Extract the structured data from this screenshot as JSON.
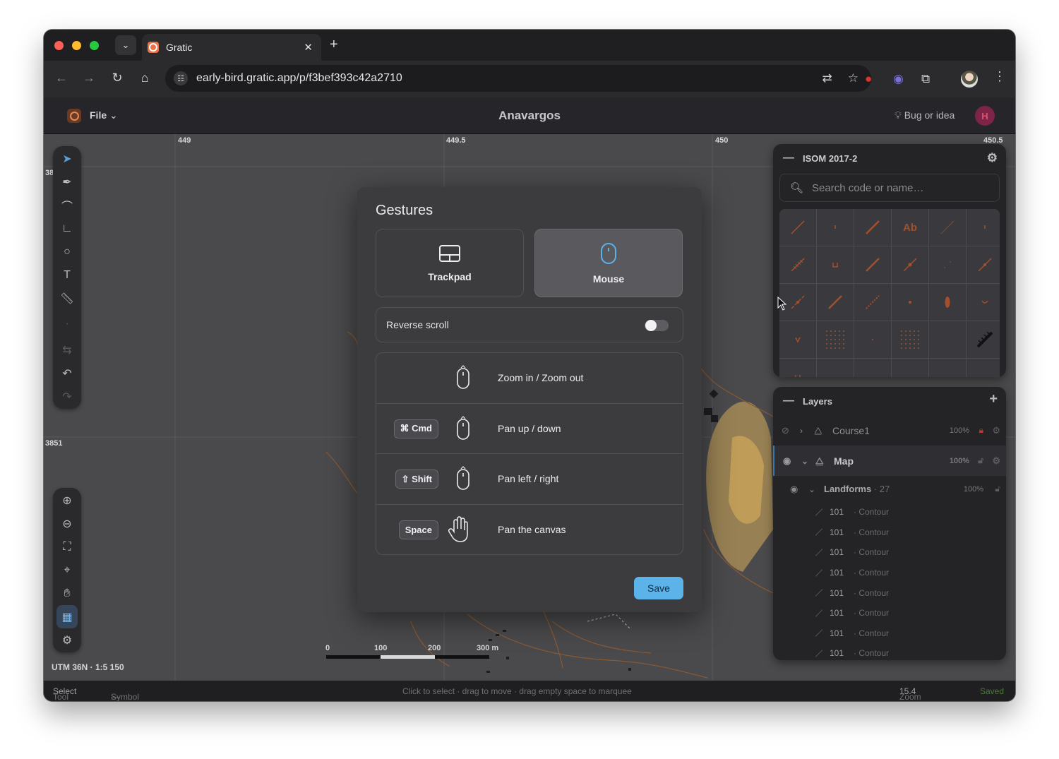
{
  "browser": {
    "tab_title": "Gratic",
    "url": "early-bird.gratic.app/p/f3bef393c42a2710",
    "new_tab_label": "+",
    "tab_close": "✕"
  },
  "app": {
    "file_menu": "File",
    "document_name": "Anavargos",
    "bug_label": "Bug or idea",
    "user_initial": "H"
  },
  "map": {
    "grid_top": [
      "449",
      "449.5",
      "450",
      "450.5"
    ],
    "grid_left": [
      "38",
      "3851"
    ],
    "scale_text": "UTM 36N · 1:5 150",
    "scalebar_labels": [
      "0",
      "100",
      "200",
      "300 m"
    ]
  },
  "symbol_panel": {
    "title": "ISOM 2017-2",
    "search_placeholder": "Search code or name…",
    "text_symbol": "Ab"
  },
  "layers_panel": {
    "title": "Layers",
    "layers": [
      {
        "name": "Course1",
        "opacity": "100%"
      },
      {
        "name": "Map",
        "opacity": "100%"
      }
    ],
    "group": {
      "name": "Landforms",
      "count": "· 27",
      "opacity": "100%"
    },
    "items": [
      {
        "code": "101",
        "name": "· Contour"
      },
      {
        "code": "101",
        "name": "· Contour"
      },
      {
        "code": "101",
        "name": "· Contour"
      },
      {
        "code": "101",
        "name": "· Contour"
      },
      {
        "code": "101",
        "name": "· Contour"
      },
      {
        "code": "101",
        "name": "· Contour"
      },
      {
        "code": "101",
        "name": "· Contour"
      },
      {
        "code": "101",
        "name": "· Contour"
      }
    ]
  },
  "modal": {
    "title": "Gestures",
    "options": [
      {
        "label": "Trackpad",
        "selected": false
      },
      {
        "label": "Mouse",
        "selected": true
      }
    ],
    "reverse_scroll_label": "Reverse scroll",
    "reverse_scroll_on": false,
    "gestures": [
      {
        "key": "",
        "label": "Zoom in / Zoom out"
      },
      {
        "key": "⌘ Cmd",
        "label": "Pan up / down"
      },
      {
        "key": "⇧ Shift",
        "label": "Pan left / right"
      },
      {
        "key": "Space",
        "label": "Pan the canvas"
      }
    ],
    "save_label": "Save"
  },
  "status": {
    "tool_prefix": "Tool",
    "tool_value": "Select",
    "symbol_prefix": "Symbol",
    "symbol_value": "—",
    "hint": "Click to select · drag to move · drag empty space to marquee",
    "zoom_prefix": "Zoom",
    "zoom_value": "15.4",
    "save_state": "Saved"
  },
  "colors": {
    "accent": "#5cb3ea",
    "symbol_brown": "#a44f2c",
    "user_avatar": "#7e2448"
  }
}
